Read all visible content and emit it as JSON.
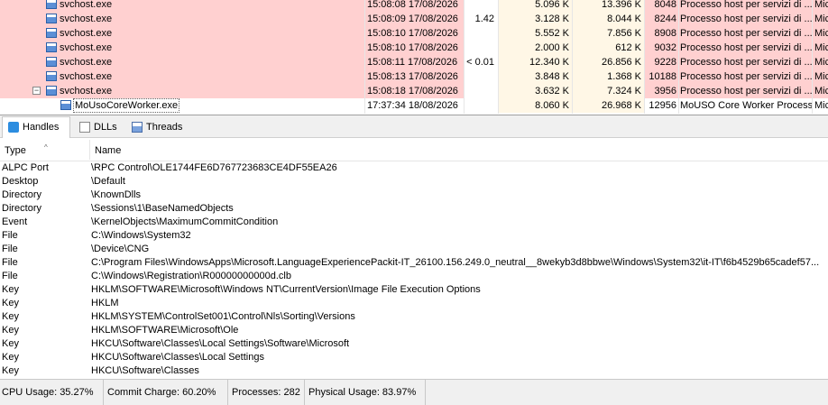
{
  "processes": [
    {
      "name": "svchost.exe",
      "start": "15:08:08 17/08/2026",
      "cpu": "",
      "private": "5.096 K",
      "working_set": "13.396 K",
      "pid": "8048",
      "description": "Processo host per servizi di ...",
      "company": "Mic"
    },
    {
      "name": "svchost.exe",
      "start": "15:08:09 17/08/2026",
      "cpu": "1.42",
      "private": "3.128 K",
      "working_set": "8.044 K",
      "pid": "8244",
      "description": "Processo host per servizi di ...",
      "company": "Mic"
    },
    {
      "name": "svchost.exe",
      "start": "15:08:10 17/08/2026",
      "cpu": "",
      "private": "5.552 K",
      "working_set": "7.856 K",
      "pid": "8908",
      "description": "Processo host per servizi di ...",
      "company": "Mic"
    },
    {
      "name": "svchost.exe",
      "start": "15:08:10 17/08/2026",
      "cpu": "",
      "private": "2.000 K",
      "working_set": "612 K",
      "pid": "9032",
      "description": "Processo host per servizi di ...",
      "company": "Mic"
    },
    {
      "name": "svchost.exe",
      "start": "15:08:11 17/08/2026",
      "cpu": "< 0.01",
      "private": "12.340 K",
      "working_set": "26.856 K",
      "pid": "9228",
      "description": "Processo host per servizi di ...",
      "company": "Mic"
    },
    {
      "name": "svchost.exe",
      "start": "15:08:13 17/08/2026",
      "cpu": "",
      "private": "3.848 K",
      "working_set": "1.368 K",
      "pid": "10188",
      "description": "Processo host per servizi di ...",
      "company": "Mic"
    },
    {
      "name": "svchost.exe",
      "start": "15:08:18 17/08/2026",
      "cpu": "",
      "private": "3.632 K",
      "working_set": "7.324 K",
      "pid": "3956",
      "description": "Processo host per servizi di ...",
      "company": "Mic"
    },
    {
      "name": "MoUsoCoreWorker.exe",
      "start": "17:37:34 18/08/2026",
      "cpu": "",
      "private": "8.060 K",
      "working_set": "26.968 K",
      "pid": "12956",
      "description": "MoUSO Core Worker Process",
      "company": "Mic"
    }
  ],
  "tabs": [
    {
      "label": "Handles",
      "icon": "handles-icon"
    },
    {
      "label": "DLLs",
      "icon": "dll-icon"
    },
    {
      "label": "Threads",
      "icon": "threads-icon"
    }
  ],
  "handles_header": {
    "type": "Type",
    "name": "Name"
  },
  "handles": [
    {
      "type": "ALPC Port",
      "name": "\\RPC Control\\OLE1744FE6D767723683CE4DF55EA26"
    },
    {
      "type": "Desktop",
      "name": "\\Default"
    },
    {
      "type": "Directory",
      "name": "\\KnownDlls"
    },
    {
      "type": "Directory",
      "name": "\\Sessions\\1\\BaseNamedObjects"
    },
    {
      "type": "Event",
      "name": "\\KernelObjects\\MaximumCommitCondition"
    },
    {
      "type": "File",
      "name": "C:\\Windows\\System32"
    },
    {
      "type": "File",
      "name": "\\Device\\CNG"
    },
    {
      "type": "File",
      "name": "C:\\Program Files\\WindowsApps\\Microsoft.LanguageExperiencePackit-IT_26100.156.249.0_neutral__8wekyb3d8bbwe\\Windows\\System32\\it-IT\\f6b4529b65cadef57..."
    },
    {
      "type": "File",
      "name": "C:\\Windows\\Registration\\R00000000000d.clb"
    },
    {
      "type": "Key",
      "name": "HKLM\\SOFTWARE\\Microsoft\\Windows NT\\CurrentVersion\\Image File Execution Options"
    },
    {
      "type": "Key",
      "name": "HKLM"
    },
    {
      "type": "Key",
      "name": "HKLM\\SYSTEM\\ControlSet001\\Control\\Nls\\Sorting\\Versions"
    },
    {
      "type": "Key",
      "name": "HKLM\\SOFTWARE\\Microsoft\\Ole"
    },
    {
      "type": "Key",
      "name": "HKCU\\Software\\Classes\\Local Settings\\Software\\Microsoft"
    },
    {
      "type": "Key",
      "name": "HKCU\\Software\\Classes\\Local Settings"
    },
    {
      "type": "Key",
      "name": "HKCU\\Software\\Classes"
    }
  ],
  "status": {
    "cpu": "CPU Usage: 35.27%",
    "commit": "Commit Charge: 60.20%",
    "processes": "Processes: 282",
    "physical": "Physical Usage: 83.97%"
  }
}
